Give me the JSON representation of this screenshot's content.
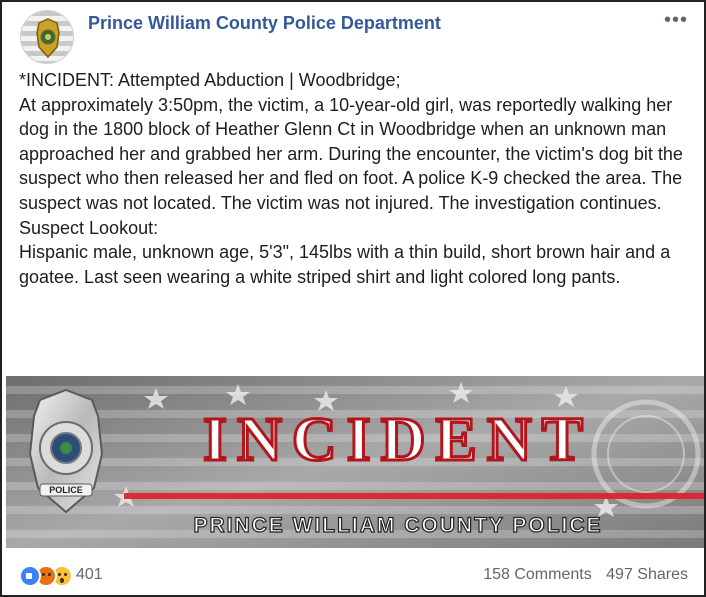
{
  "page": {
    "name": "Prince William County Police Department",
    "more_icon": "more-horizontal-icon"
  },
  "post": {
    "lines": [
      "*INCIDENT: Attempted Abduction | Woodbridge;",
      "At approximately 3:50pm, the victim, a 10-year-old girl, was reportedly walking her dog in the 1800 block of Heather Glenn Ct in Woodbridge when an unknown man approached her and grabbed her arm. During the encounter, the victim's dog bit the suspect who then released her and fled on foot. A police K-9 checked the area. The suspect was not located. The victim was not injured. The investigation continues.",
      "Suspect Lookout:",
      "Hispanic male, unknown age, 5'3\", 145lbs with a thin build, short brown hair and a goatee. Last seen wearing a white striped shirt and light colored long pants."
    ]
  },
  "banner": {
    "headline": "INCIDENT",
    "subtitle": "PRINCE WILLIAM COUNTY POLICE",
    "badge_text": "POLICE",
    "accent_color": "#e0232b"
  },
  "footer": {
    "reaction_icons": [
      "like-reaction-icon",
      "angry-reaction-icon",
      "wow-reaction-icon"
    ],
    "reaction_count": "401",
    "comments": "158 Comments",
    "shares": "497 Shares"
  }
}
